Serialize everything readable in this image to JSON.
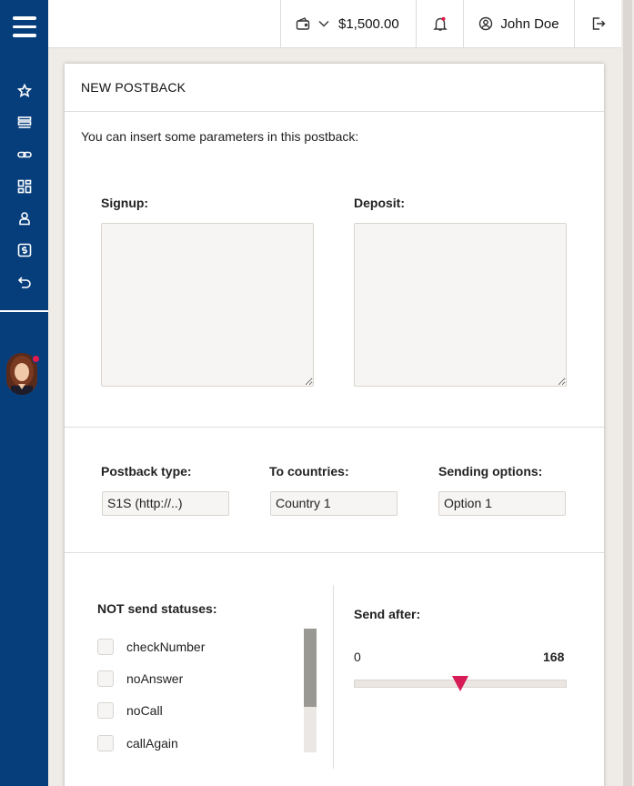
{
  "topbar": {
    "balance": "$1,500.00",
    "user_name": "John Doe"
  },
  "sidebar": {
    "items": [
      {
        "icon": "star-icon"
      },
      {
        "icon": "list-icon"
      },
      {
        "icon": "link-icon"
      },
      {
        "icon": "dashboard-icon"
      },
      {
        "icon": "user-icon"
      },
      {
        "icon": "money-icon"
      },
      {
        "icon": "undo-icon"
      }
    ]
  },
  "card": {
    "title": "NEW POSTBACK",
    "intro": "You can insert some parameters in this postback:",
    "signup_label": "Signup:",
    "deposit_label": "Deposit:",
    "postback_type_label": "Postback type:",
    "postback_type_value": "S1S (http://..)",
    "countries_label": "To countries:",
    "countries_value": "Country 1",
    "sending_label": "Sending options:",
    "sending_value": "Option 1",
    "statuses_label": "NOT send statuses:",
    "statuses": [
      "checkNumber",
      "noAnswer",
      "noCall",
      "callAgain"
    ],
    "send_after_label": "Send after:",
    "range_min": "0",
    "range_max": "168",
    "range_value_fraction": 0.5
  },
  "colors": {
    "sidebar": "#063e7c",
    "accent": "#d61b56",
    "notification": "#e51a4a"
  }
}
